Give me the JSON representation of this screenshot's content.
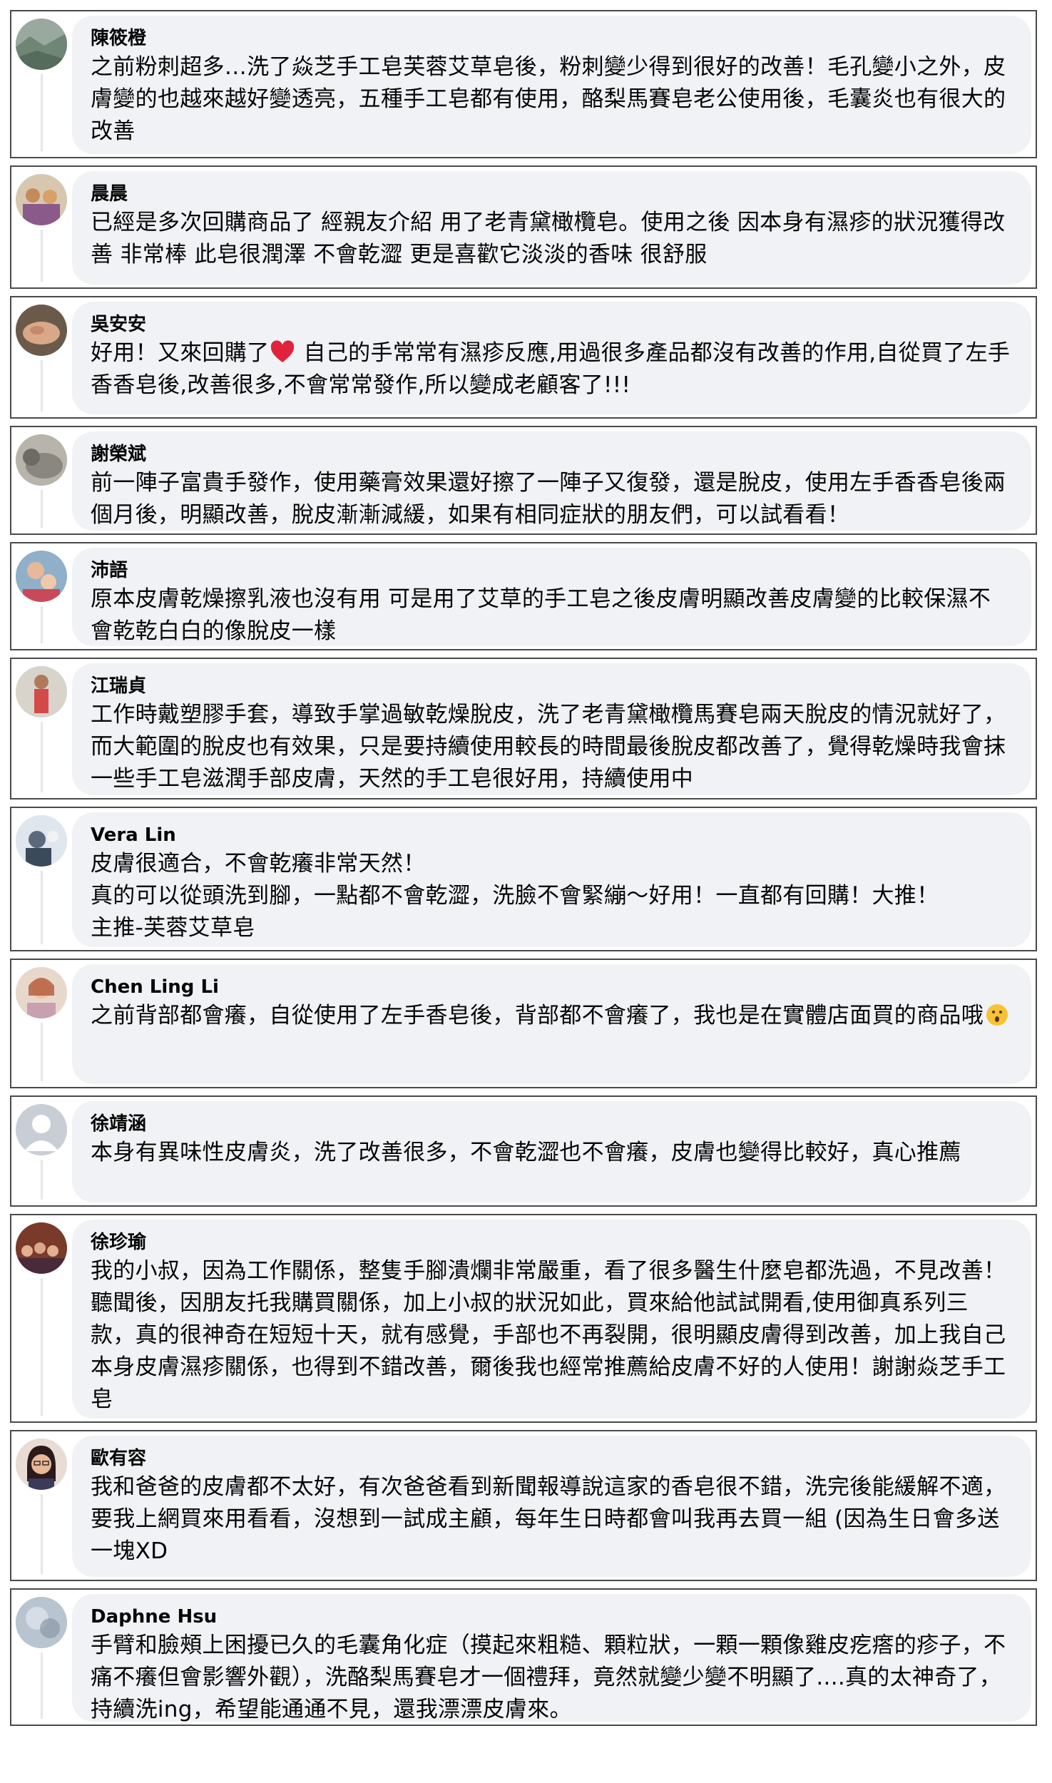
{
  "comments": [
    {
      "name": "陳筱橙",
      "text": "之前粉刺超多…洗了焱芝手工皂芙蓉艾草皂後，粉刺變少得到很好的改善！毛孔變小之外，皮膚變的也越來越好變透亮，五種手工皂都有使用，酪梨馬賽皂老公使用後，毛囊炎也有很大的改善",
      "avatar": "landscape-photo",
      "color": "#7f9a8a"
    },
    {
      "name": "晨晨",
      "text": "已經是多次回購商品了 經親友介紹 用了老青黛橄欖皂。使用之後 因本身有濕疹的狀況獲得改善 非常棒 此皂很潤澤 不會乾澀 更是喜歡它淡淡的香味 很舒服",
      "avatar": "group-photo",
      "color": "#d8a06a"
    },
    {
      "name": "吳安安",
      "text_before": "好用！又來回購了",
      "emoji": "red-heart",
      "text_after": " 自己的手常常有濕疹反應,用過很多產品都沒有改善的作用,自從買了左手香香皂後,改善很多,不會常常發作,所以變成老顧客了!!!",
      "avatar": "hands-photo",
      "color": "#b87c5c"
    },
    {
      "name": "謝榮斌",
      "text": "前一陣子富貴手發作，使用藥膏效果還好擦了一陣子又復發，還是脫皮，使用左手香香皂後兩個月後，明顯改善，脫皮漸漸減緩，如果有相同症狀的朋友們，可以試看看！",
      "avatar": "cat-photo",
      "color": "#8b8f94"
    },
    {
      "name": "沛語",
      "text": "原本皮膚乾燥擦乳液也沒有用 可是用了艾草的手工皂之後皮膚明顯改善皮膚變的比較保濕不會乾乾白白的像脫皮一樣",
      "avatar": "family-photo",
      "color": "#c89a82"
    },
    {
      "name": "江瑞貞",
      "text": "工作時戴塑膠手套，導致手掌過敏乾燥脫皮，洗了老青黛橄欖馬賽皂兩天脫皮的情況就好了，而大範圍的脫皮也有效果，只是要持續使用較長的時間最後脫皮都改善了，覺得乾燥時我會抹一些手工皂滋潤手部皮膚，天然的手工皂很好用，持續使用中",
      "avatar": "person-photo",
      "color": "#d46a5a"
    },
    {
      "name": "Vera Lin",
      "text": "皮膚很適合，不會乾癢非常天然！\n真的可以從頭洗到腳，一點都不會乾澀，洗臉不會緊繃～好用！一直都有回購！大推！\n主推-芙蓉艾草皂",
      "avatar": "snow-photo",
      "color": "#8fa3b8"
    },
    {
      "name": "Chen Ling Li",
      "text_before": "之前背部都會癢，自從使用了左手香皂後，背部都不會癢了，我也是在實體店面買的商品哦",
      "emoji": "surprised-face",
      "text_after": "",
      "avatar": "woman-photo",
      "color": "#d9a58c"
    },
    {
      "name": "徐靖涵",
      "text": "本身有異味性皮膚炎，洗了改善很多，不會乾澀也不會癢，皮膚也變得比較好，真心推薦",
      "avatar": "default-avatar",
      "color": "#c9ced6"
    },
    {
      "name": "徐珍瑜",
      "text": "我的小叔，因為工作關係，整隻手腳潰爛非常嚴重，看了很多醫生什麼皂都洗過，不見改善！聽聞後，因朋友托我購買關係，加上小叔的狀況如此，買來給他試試開看,使用御真系列三款，真的很神奇在短短十天，就有感覺，手部也不再裂開，很明顯皮膚得到改善，加上我自己本身皮膚濕疹關係，也得到不錯改善，爾後我也經常推薦給皮膚不好的人使用！謝謝焱芝手工皂",
      "avatar": "crowd-photo",
      "color": "#9a4a3a"
    },
    {
      "name": "歐有容",
      "text": "我和爸爸的皮膚都不太好，有次爸爸看到新聞報導說這家的香皂很不錯，洗完後能緩解不適，要我上網買來用看看，沒想到一試成主顧，每年生日時都會叫我再去買一組 (因為生日會多送一塊XD",
      "avatar": "glasses-woman-photo",
      "color": "#c48a6a"
    },
    {
      "name": "Daphne Hsu",
      "text": "手臂和臉頰上困擾已久的毛囊角化症（摸起來粗糙、顆粒狀，一顆一顆像雞皮疙瘩的疹子，不痛不癢但會影響外觀），洗酪梨馬賽皂才一個禮拜，竟然就變少變不明顯了....真的太神奇了，持續洗ing，希望能通通不見，還我漂漂皮膚來。",
      "avatar": "sky-photo",
      "color": "#a9b6c4"
    }
  ]
}
